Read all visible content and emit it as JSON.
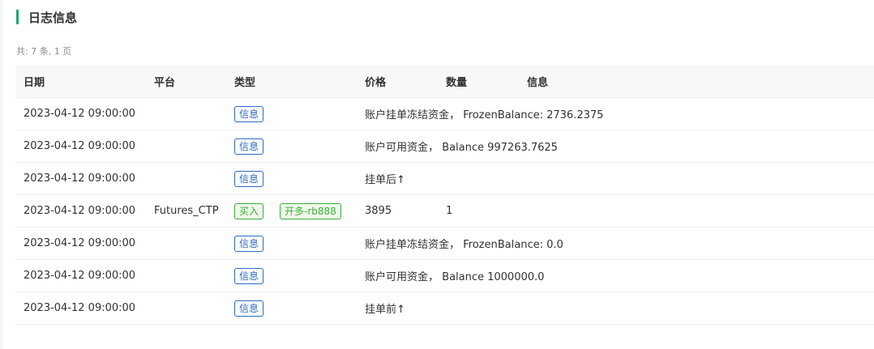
{
  "title": "日志信息",
  "summary": "共: 7 条, 1 页",
  "columns": {
    "date": "日期",
    "platform": "平台",
    "type": "类型",
    "price": "价格",
    "amount": "数量",
    "info": "信息"
  },
  "colors": {
    "accent": "#1aa97a",
    "info_tag": "#2b6cc4",
    "buy_tag": "#3cae3c"
  },
  "rows": [
    {
      "date": "2023-04-12 09:00:00",
      "type": "信息",
      "message": "账户挂单冻结资金， FrozenBalance: 2736.2375"
    },
    {
      "date": "2023-04-12 09:00:00",
      "type": "信息",
      "message": "账户可用资金， Balance 997263.7625"
    },
    {
      "date": "2023-04-12 09:00:00",
      "type": "信息",
      "message": "挂单后↑"
    },
    {
      "date": "2023-04-12 09:00:00",
      "platform": "Futures_CTP",
      "type": "买入",
      "action": "开多-rb888",
      "price": "3895",
      "amount": "1"
    },
    {
      "date": "2023-04-12 09:00:00",
      "type": "信息",
      "message": "账户挂单冻结资金， FrozenBalance: 0.0"
    },
    {
      "date": "2023-04-12 09:00:00",
      "type": "信息",
      "message": "账户可用资金， Balance 1000000.0"
    },
    {
      "date": "2023-04-12 09:00:00",
      "type": "信息",
      "message": "挂单前↑"
    }
  ]
}
